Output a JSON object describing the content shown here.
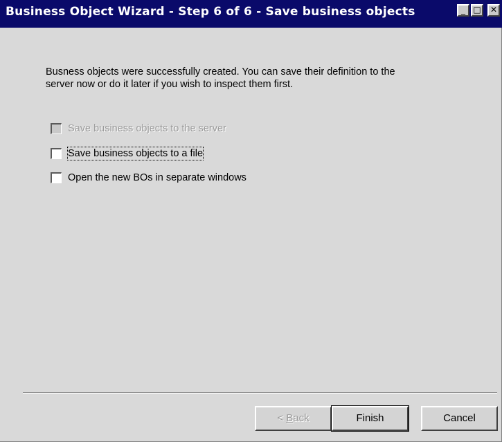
{
  "window": {
    "title": "Business Object Wizard - Step 6 of 6 - Save business objects",
    "controls": {
      "minimize": "_",
      "maximize": "□",
      "close": "✕"
    }
  },
  "intro": {
    "line1": "Busness objects were successfully created. You can save their definition to the",
    "line2": "server now or do it later if you wish to inspect them first."
  },
  "options": [
    {
      "label": "Save business objects to the server",
      "checked": false,
      "enabled": false
    },
    {
      "label": "Save business objects to a file",
      "checked": false,
      "enabled": true
    },
    {
      "label": "Open the new BOs in separate windows",
      "checked": false,
      "enabled": true
    }
  ],
  "buttons": {
    "back_mnemonic": "B",
    "back_rest": "ack",
    "back_prefix": "< ",
    "finish": "Finish",
    "cancel": "Cancel"
  },
  "colors": {
    "titlebar": "#0a0a6a",
    "face": "#d9d9d9"
  }
}
